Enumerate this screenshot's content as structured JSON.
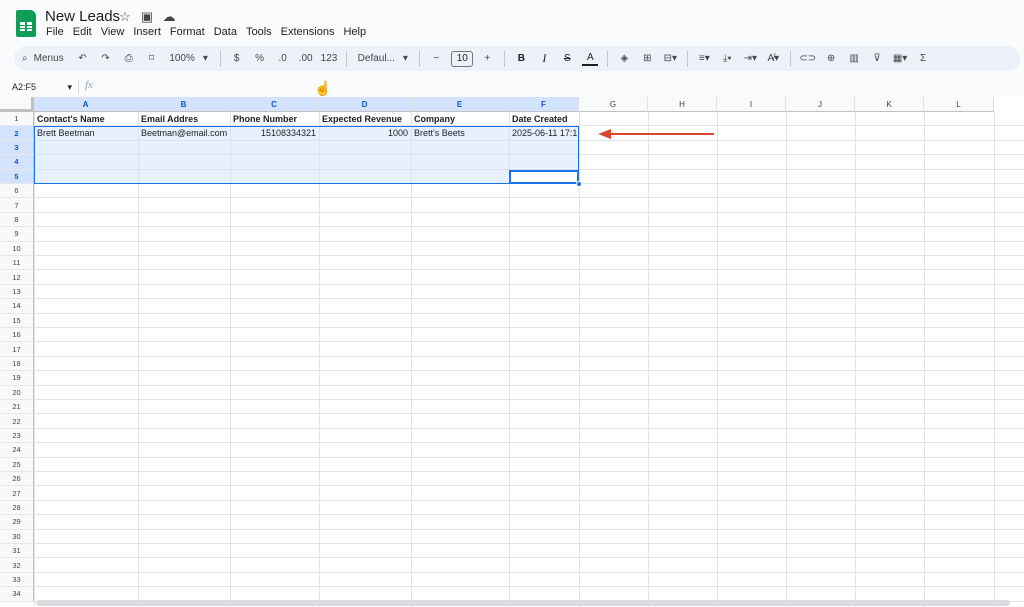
{
  "title_bar": {
    "doc_title": "New Leads",
    "icons": [
      "star-icon",
      "move-to-folder-icon",
      "cloud-status-icon"
    ]
  },
  "menu": [
    "File",
    "Edit",
    "View",
    "Insert",
    "Format",
    "Data",
    "Tools",
    "Extensions",
    "Help"
  ],
  "toolbar": {
    "search_label": "Menus",
    "zoom": "100%",
    "currency": "$",
    "percent": "%",
    "dec_decrease": ".0",
    "dec_increase": ".00",
    "more_formats": "123",
    "font_name": "Defaul...",
    "font_size": "10",
    "minus": "−",
    "plus": "+",
    "bold": "B",
    "italic": "I",
    "strike": "S",
    "text_color": "A",
    "sum": "Σ"
  },
  "formula_bar": {
    "name_box": "A2:F5",
    "fx": "fx",
    "value": ""
  },
  "columns": [
    "A",
    "B",
    "C",
    "D",
    "E",
    "F",
    "G",
    "H",
    "I",
    "J",
    "K",
    "L"
  ],
  "rows": [
    "1",
    "2",
    "3",
    "4",
    "5",
    "6",
    "7",
    "8",
    "9",
    "10",
    "11",
    "12",
    "13",
    "14",
    "15",
    "16",
    "17",
    "18",
    "19",
    "20",
    "21",
    "22",
    "23",
    "24",
    "25",
    "26",
    "27",
    "28",
    "29",
    "30",
    "31",
    "32",
    "33",
    "34"
  ],
  "sheet": {
    "headers": [
      "Contact's Name",
      "Email Addres",
      "Phone Number",
      "Expected Revenue",
      "Company",
      "Date Created"
    ],
    "row2": [
      "Brett Beetman",
      "Beetman@email.com",
      "15108334321",
      "1000",
      "Brett's Beets",
      "2025-06-11 17:1"
    ]
  },
  "selection": {
    "range": "A2:F5",
    "active_cell": "F5",
    "highlight_color": "#d3e3fd",
    "border_color": "#1a73e8"
  },
  "annotation_arrow_color": "#d9462b"
}
